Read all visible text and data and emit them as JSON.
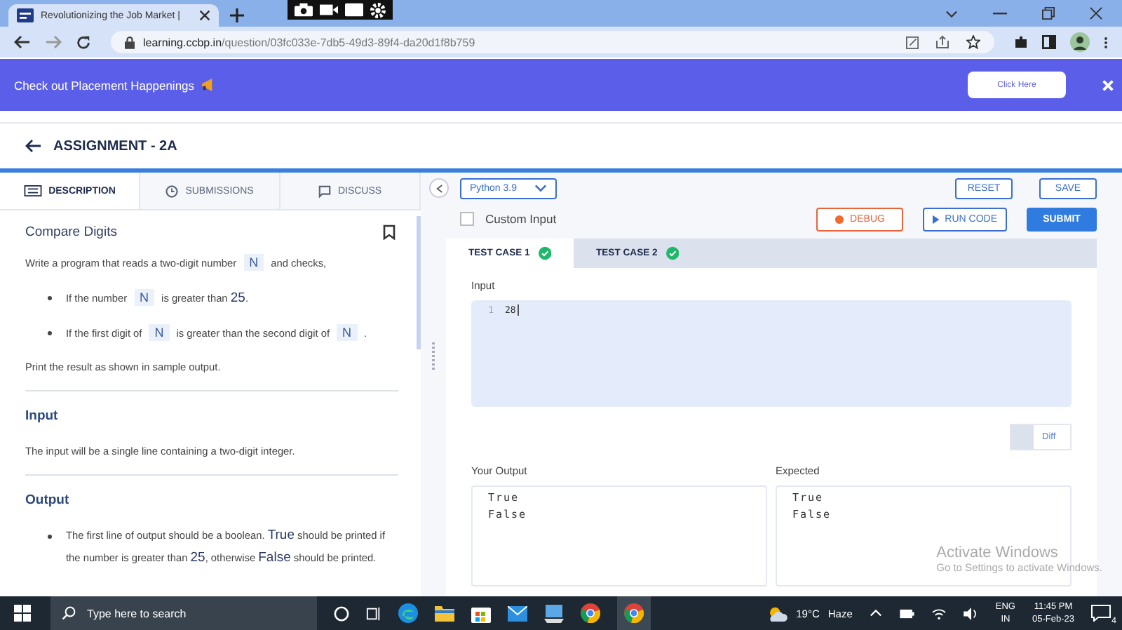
{
  "browser": {
    "tab_title": "Revolutionizing the Job Market |",
    "url_host": "learning.ccbp.in",
    "url_path": "/question/03fc033e-7db5-49d3-89f4-da20d1f8b759"
  },
  "banner": {
    "text": "Check out Placement Happenings",
    "button": "Click Here"
  },
  "header": {
    "title": "ASSIGNMENT - 2A"
  },
  "left_tabs": [
    {
      "label": "DESCRIPTION",
      "selected": true
    },
    {
      "label": "SUBMISSIONS",
      "selected": false
    },
    {
      "label": "DISCUSS",
      "selected": false
    }
  ],
  "problem": {
    "title": "Compare Digits",
    "blocks": [
      {
        "kind": "para",
        "parts": [
          {
            "kind": "text",
            "text": "Write a program that reads a two-digit number"
          },
          {
            "kind": "code",
            "text": "N"
          },
          {
            "kind": "text",
            "text": "and checks,"
          }
        ]
      },
      {
        "kind": "bullet",
        "parts": [
          {
            "kind": "text",
            "text": "If the number"
          },
          {
            "kind": "code",
            "text": "N"
          },
          {
            "kind": "text",
            "text": "is greater than **25**."
          }
        ]
      },
      {
        "kind": "bullet",
        "parts": [
          {
            "kind": "text",
            "text": "If the first digit of"
          },
          {
            "kind": "code",
            "text": "N"
          },
          {
            "kind": "text",
            "text": "is greater than the second digit of"
          },
          {
            "kind": "code",
            "text": "N"
          },
          {
            "kind": "text",
            "text": "."
          }
        ]
      },
      {
        "kind": "para",
        "parts": [
          {
            "kind": "text",
            "text": "Print the result as shown in sample output."
          }
        ]
      },
      {
        "kind": "heading",
        "text": "Input"
      },
      {
        "kind": "para",
        "parts": [
          {
            "kind": "text",
            "text": "The input will be a single line containing a two-digit integer."
          }
        ]
      },
      {
        "kind": "heading",
        "text": "Output"
      },
      {
        "kind": "bullet",
        "parts": [
          {
            "kind": "text",
            "text": "The first line of output should be a boolean. **True** should be printed if the number is greater than **25**, otherwise **False** should be printed."
          }
        ]
      }
    ]
  },
  "editor": {
    "language": "Python 3.9",
    "reset": "RESET",
    "save": "SAVE",
    "custom_input": {
      "label": "Custom Input",
      "checked": false
    },
    "debug": "DEBUG",
    "run": "RUN CODE",
    "submit": "SUBMIT"
  },
  "test_cases": [
    {
      "label": "TEST CASE 1",
      "selected": true,
      "passed": true
    },
    {
      "label": "TEST CASE 2",
      "selected": false,
      "passed": true
    }
  ],
  "input": {
    "label": "Input",
    "lines": [
      {
        "number": "1",
        "code": "28"
      }
    ]
  },
  "diff": {
    "label": "Diff",
    "on": false
  },
  "your_output": {
    "label": "Your Output",
    "lines": [
      "True",
      "False"
    ]
  },
  "expected": {
    "label": "Expected",
    "lines": [
      "True",
      "False"
    ]
  },
  "activation": {
    "title": "Activate Windows",
    "text": "Go to Settings to activate Windows."
  },
  "taskbar": {
    "search_placeholder": "Type here to search",
    "temperature": "19°C",
    "weather": "Haze",
    "language": "ENG",
    "region": "IN",
    "time": "11:45 PM",
    "date": "05-Feb-23",
    "notifications": "4"
  }
}
